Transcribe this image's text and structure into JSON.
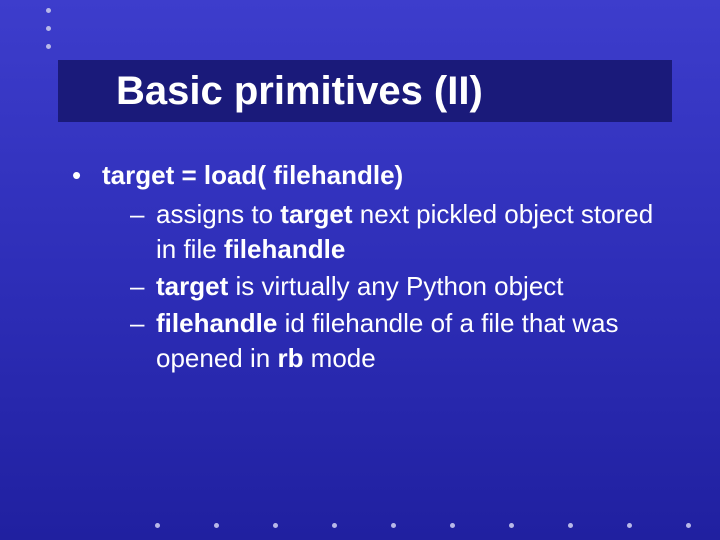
{
  "title": "Basic primitives (II)",
  "l1": {
    "prefix": "target = load( filehandle)"
  },
  "l2a": {
    "p1": "assigns to ",
    "b1": "target",
    "p2": " next pickled object stored  in file ",
    "b2": "filehandle"
  },
  "l2b": {
    "b1": "target",
    "p1": " is virtually any Python object"
  },
  "l2c": {
    "b1": "filehandle",
    "p1": " id filehandle of a file that was opened in ",
    "b2": "rb",
    "p2": " mode"
  }
}
